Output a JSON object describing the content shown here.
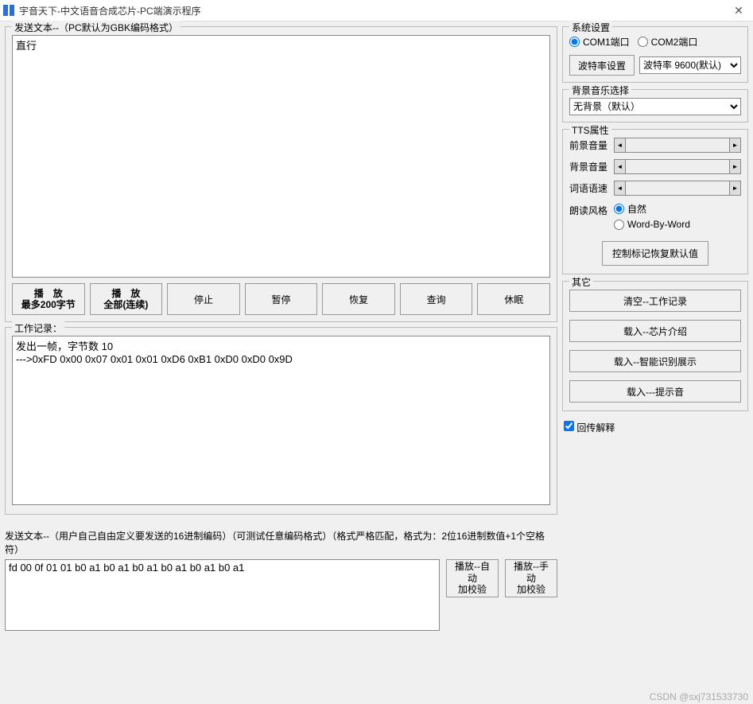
{
  "window": {
    "title": "宇音天下-中文语音合成芯片-PC端演示程序"
  },
  "send_text": {
    "legend": "发送文本--（PC默认为GBK编码格式）",
    "value": "直行"
  },
  "buttons": {
    "play200_l1": "播　放",
    "play200_l2": "最多200字节",
    "play_all_l1": "播　放",
    "play_all_l2": "全部(连续)",
    "stop": "停止",
    "pause": "暂停",
    "resume": "恢复",
    "query": "查询",
    "sleep": "休眠"
  },
  "log": {
    "legend": "工作记录：",
    "content": "发出一帧，字节数 10\n--->0xFD 0x00 0x07 0x01 0x01 0xD6 0xB1 0xD0 0xD0 0x9D"
  },
  "hex": {
    "legend": "发送文本--（用户自己自由定义要发送的16进制编码）（可测试任意编码格式）（格式严格匹配，格式为：2位16进制数值+1个空格符）",
    "value": "fd 00 0f 01 01 b0 a1 b0 a1 b0 a1 b0 a1 b0 a1 b0 a1",
    "btn_auto_l1": "播放--自动",
    "btn_auto_l2": "加校验",
    "btn_manual_l1": "播放--手动",
    "btn_manual_l2": "加校验"
  },
  "sys": {
    "legend": "系统设置",
    "com1": "COM1端口",
    "com2": "COM2端口",
    "baud_btn": "波特率设置",
    "baud_select": "波特率 9600(默认)"
  },
  "bgm": {
    "legend": "背景音乐选择",
    "select": "无背景（默认）"
  },
  "tts": {
    "legend": "TTS属性",
    "fg_vol": "前景音量",
    "bg_vol": "背景音量",
    "speed": "词语语速",
    "style": "朗读风格",
    "style_natural": "自然",
    "style_wbw": "Word-By-Word",
    "reset": "控制标记恢复默认值"
  },
  "other": {
    "legend": "其它",
    "clear": "清空--工作记录",
    "load_intro": "载入--芯片介绍",
    "load_smart": "载入--智能识别展示",
    "load_tone": "载入---提示音"
  },
  "echo": {
    "label": "回传解释"
  },
  "watermark": "CSDN @sxj731533730"
}
